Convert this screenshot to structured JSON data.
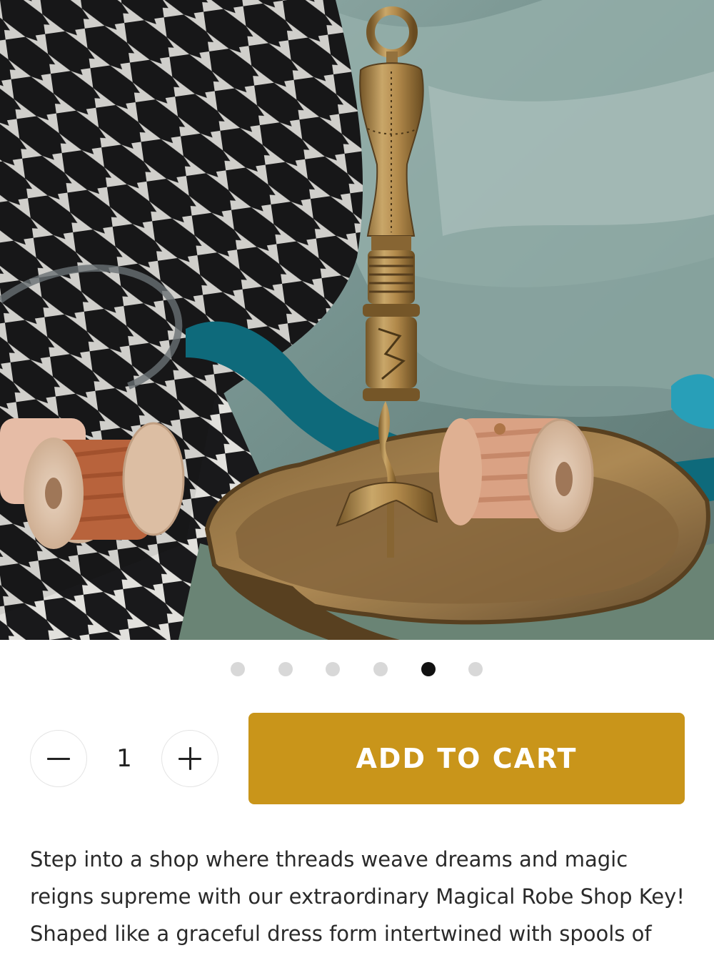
{
  "product_image": {
    "alt": "Brass dress-form key standing on an ornate tray with wooden thread spools"
  },
  "carousel": {
    "total_slides": 6,
    "active_slide": 5
  },
  "quantity": {
    "value": "1",
    "minus_icon": "minus-icon",
    "plus_icon": "plus-icon"
  },
  "cart": {
    "add_label": "ADD TO CART"
  },
  "description": {
    "text": "Step into a shop where threads weave dreams and magic reigns supreme with our extraordinary Magical Robe Shop Key! Shaped like a graceful dress form intertwined with spools of thread, this"
  },
  "colors": {
    "accent": "#c9951a",
    "active_dot": "#111111",
    "inactive_dot": "#d8d8d8",
    "text": "#2a2a2a"
  }
}
